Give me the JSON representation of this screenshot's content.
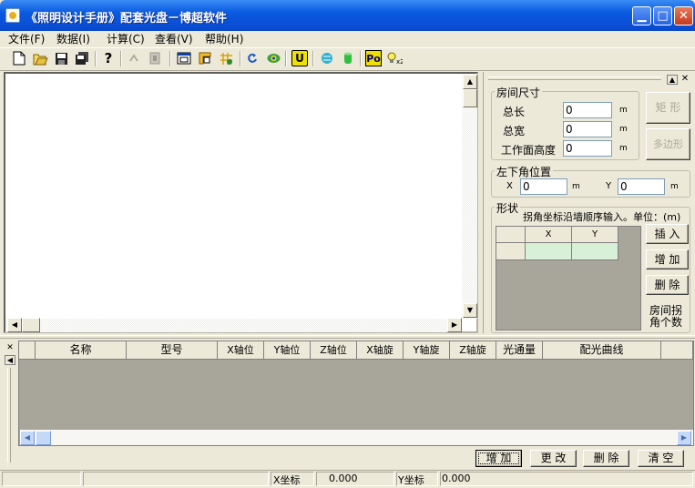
{
  "window": {
    "title": "《照明设计手册》配套光盘－博超软件",
    "minimize_glyph": "▁",
    "maximize_glyph": "□",
    "close_glyph": "✕"
  },
  "menu": [
    "文件(F)",
    "数据(I)",
    "计算(C)",
    "查看(V)",
    "帮助(H)"
  ],
  "toolbar": {
    "icons": [
      "new-file-icon",
      "open-folder-icon",
      "save-icon",
      "save-all-icon",
      "help-icon",
      "undo-icon",
      "redo-icon",
      "window-icon",
      "frame-icon",
      "grid-icon",
      "refresh-icon",
      "eye-icon",
      "u-icon",
      "globe-icon",
      "cylinder-icon",
      "po-icon",
      "lamp-icon"
    ],
    "po_label": "Po",
    "u_label": "U"
  },
  "room": {
    "group_label": "房间尺寸",
    "length_label": "总长",
    "length_value": "0",
    "width_label": "总宽",
    "width_value": "0",
    "workheight_label": "工作面高度",
    "workheight_value": "0",
    "unit": "m",
    "rect_button": "矩 形",
    "polygon_button": "多边形"
  },
  "corner": {
    "group_label": "左下角位置",
    "x_label": "X",
    "x_value": "0",
    "y_label": "Y",
    "y_value": "0",
    "unit": "m"
  },
  "shape": {
    "group_label": "形状",
    "hint": "拐角坐标沿墙顺序输入。单位：(m)",
    "col_x": "X",
    "col_y": "Y",
    "insert_button": "插 入",
    "add_button": "增 加",
    "delete_button": "删 除",
    "corner_count_label_1": "房间拐",
    "corner_count_label_2": "角个数"
  },
  "table": {
    "columns": [
      "名称",
      "型号",
      "X轴位",
      "Y轴位",
      "Z轴位",
      "X轴旋",
      "Y轴旋",
      "Z轴旋",
      "光通量",
      "配光曲线"
    ]
  },
  "actions": {
    "add": "增 加",
    "modify": "更 改",
    "delete": "删 除",
    "clear": "清 空"
  },
  "status": {
    "x_label": "X坐标",
    "x_value": "0.000",
    "y_label": "Y坐标",
    "y_value": "0.000"
  }
}
